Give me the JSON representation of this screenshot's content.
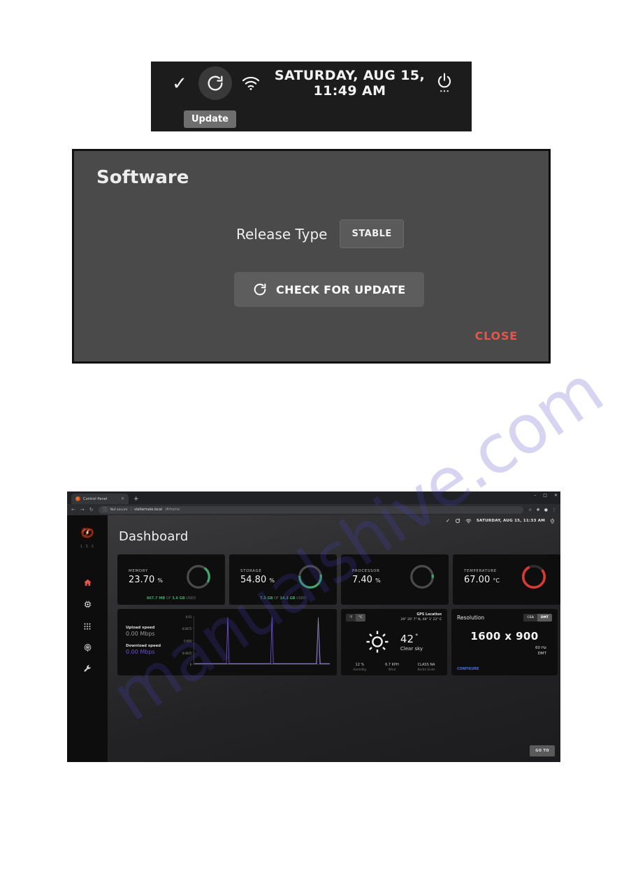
{
  "status_strip": {
    "check_icon": "check-icon",
    "update_icon": "update-refresh-icon",
    "wifi_icon": "wifi-icon",
    "datetime": "SATURDAY, AUG 15, 11:49 AM",
    "power_icon": "power-icon",
    "tooltip": "Update"
  },
  "software_dialog": {
    "title": "Software",
    "release_type_label": "Release Type",
    "release_type_value": "STABLE",
    "check_update_label": "CHECK FOR UPDATE",
    "check_update_icon": "update-refresh-icon",
    "close_label": "CLOSE",
    "close_color": "#e2574c"
  },
  "browser": {
    "tab_title": "Control Panel",
    "tab_close_icon": "close-icon",
    "new_tab_icon": "plus-icon",
    "minimize_icon": "minimize-icon",
    "maximize_icon": "maximize-icon",
    "window_close_icon": "close-icon",
    "back_icon": "arrow-left-icon",
    "forward_icon": "arrow-right-icon",
    "reload_icon": "reload-icon",
    "security_icon": "info-circle-icon",
    "security_label": "Not secure",
    "url_host": "stellarmate.local",
    "url_path": "/#/home",
    "bookmark_icon": "star-icon",
    "extension_icon": "puzzle-icon",
    "profile_icon": "profile-icon",
    "menu_icon": "three-dots-icon"
  },
  "app": {
    "logo_icon": "galaxy-spiral-logo",
    "version": "1.5.3",
    "nav": [
      {
        "icon": "home-icon",
        "name": "sidebar-item-home",
        "active": true
      },
      {
        "icon": "chip-icon",
        "name": "sidebar-item-devices",
        "active": false
      },
      {
        "icon": "apps-grid-icon",
        "name": "sidebar-item-apps",
        "active": false
      },
      {
        "icon": "observatory-icon",
        "name": "sidebar-item-observatory",
        "active": false
      },
      {
        "icon": "wrench-icon",
        "name": "sidebar-item-tools",
        "active": false
      }
    ],
    "topbar": {
      "check_icon": "check-icon",
      "update_icon": "update-refresh-icon",
      "wifi_icon": "wifi-icon",
      "datetime": "SATURDAY, AUG 15, 11:33 AM",
      "power_icon": "power-icon"
    },
    "page_title": "Dashboard",
    "gauges": [
      {
        "label": "MEMORY",
        "value": "23.70",
        "unit": "%",
        "percent": 23.7,
        "color": "#3ea76a",
        "sub_used": "867.7 MB",
        "sub_of": "OF",
        "sub_total": "3.6 GB",
        "sub_suffix": "USED"
      },
      {
        "label": "STORAGE",
        "value": "54.80",
        "unit": "%",
        "percent": 54.8,
        "color": "#3ea76a",
        "sub_used": "7.5 GB",
        "sub_of": "OF",
        "sub_total": "14.3 GB",
        "sub_suffix": "USED"
      },
      {
        "label": "PROCESSOR",
        "value": "7.40",
        "unit": "%",
        "percent": 7.4,
        "color": "#3ea76a",
        "sub_used": "",
        "sub_of": "",
        "sub_total": "",
        "sub_suffix": ""
      },
      {
        "label": "TEMPERATURE",
        "value": "67.00",
        "unit": "°C",
        "percent": 67.0,
        "color": "#d93a33",
        "sub_used": "",
        "sub_of": "",
        "sub_total": "",
        "sub_suffix": ""
      }
    ],
    "network": {
      "upload_label": "Upload speed",
      "upload_value": "0.00 Mbps",
      "download_label": "Download speed",
      "download_value": "0.00 Mbps"
    },
    "weather": {
      "unit_f": "°F",
      "unit_c": "°C",
      "selected_unit": "°C",
      "gps_title": "GPS Location",
      "gps_coords": "29° 20' 7\" N, 48° 1' 22\" E",
      "icon": "sun-icon",
      "temperature": "42",
      "degree": "°",
      "condition": "Clear sky",
      "stats": [
        {
          "value": "12 %",
          "label": "Humidity"
        },
        {
          "value": "6.7 KPH",
          "label": "Wind"
        },
        {
          "value": "CLASS NA",
          "label": "Bortle Scale"
        }
      ]
    },
    "resolution": {
      "title": "Resolution",
      "toggle_cea": "CEA",
      "toggle_dmt": "DMT",
      "selected_toggle": "DMT",
      "value": "1600 x 900",
      "refresh": "60 Hz",
      "mode": "DMT",
      "configure_label": "CONFIGURE"
    },
    "goto_label": "GO TO"
  },
  "watermark": {
    "text": "manualshive.com"
  },
  "chart_data": {
    "type": "line",
    "title": "",
    "xlabel": "",
    "ylabel": "",
    "ylim": [
      0,
      0.01
    ],
    "ytick_labels": [
      "0.01",
      "0.0075",
      "0.005",
      "0.0025",
      "0"
    ],
    "ytick_values": [
      0.01,
      0.0075,
      0.005,
      0.0025,
      0
    ],
    "grid": false,
    "legend_position": "left",
    "series": [
      {
        "name": "Upload speed",
        "color": "#9a9a9a",
        "current_value": 0.0,
        "unit": "Mbps",
        "values": [
          0,
          0,
          0,
          0,
          0,
          0,
          0,
          0,
          0,
          0,
          0,
          0,
          0,
          0,
          0,
          0,
          0,
          0,
          0,
          0,
          0,
          0,
          0,
          0,
          0,
          0,
          0,
          0,
          0,
          0,
          0,
          0,
          0,
          0,
          0,
          0,
          0,
          0,
          0,
          0,
          0,
          0,
          0,
          0,
          0,
          0,
          0,
          0.0095,
          0,
          0,
          0,
          0,
          0,
          0,
          0,
          0,
          0,
          0,
          0,
          0
        ]
      },
      {
        "name": "Download speed",
        "color": "#6f50d8",
        "current_value": 0.0,
        "unit": "Mbps",
        "values": [
          0,
          0,
          0,
          0,
          0,
          0,
          0,
          0,
          0,
          0,
          0,
          0,
          0,
          0,
          0.01,
          0,
          0,
          0,
          0,
          0,
          0,
          0,
          0,
          0,
          0,
          0,
          0,
          0,
          0,
          0,
          0,
          0,
          0,
          0,
          0,
          0,
          0,
          0,
          0.01,
          0,
          0,
          0,
          0,
          0,
          0,
          0,
          0,
          0,
          0,
          0,
          0,
          0,
          0,
          0,
          0,
          0,
          0,
          0,
          0,
          0
        ]
      }
    ]
  }
}
